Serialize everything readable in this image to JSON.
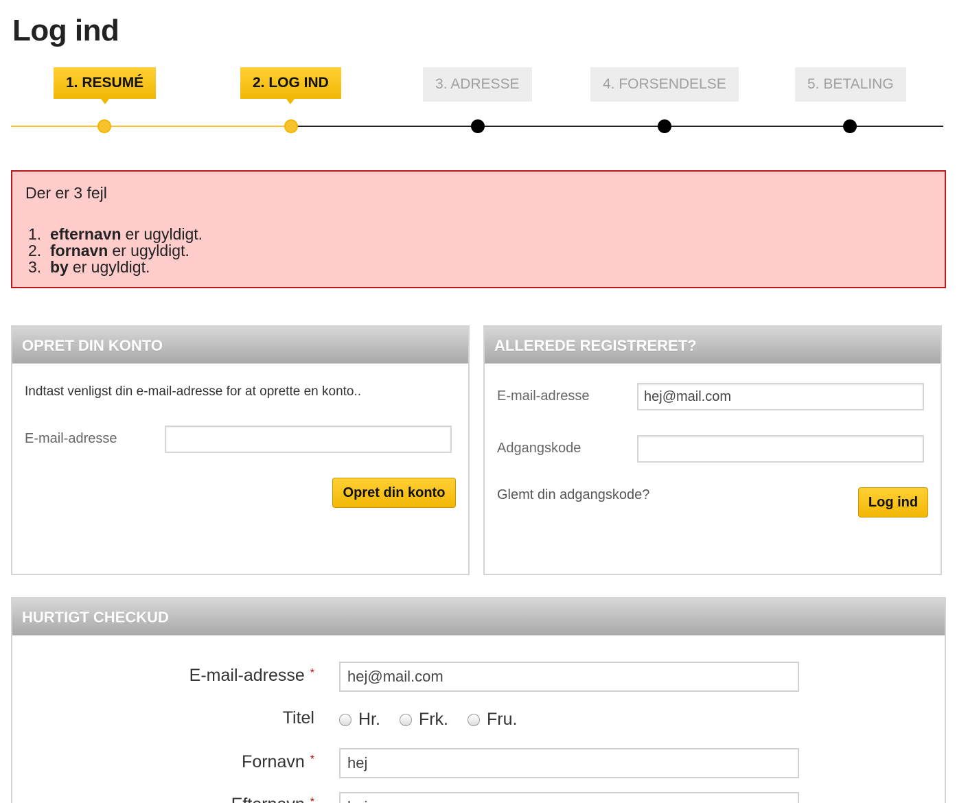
{
  "page": {
    "title": "Log ind"
  },
  "steps": [
    {
      "label": "1. RESUMÉ",
      "state": "active"
    },
    {
      "label": "2. LOG IND",
      "state": "active"
    },
    {
      "label": "3. ADRESSE",
      "state": "inactive"
    },
    {
      "label": "4. FORSENDELSE",
      "state": "inactive"
    },
    {
      "label": "5. BETALING",
      "state": "inactive"
    }
  ],
  "errors": {
    "title": "Der er 3 fejl",
    "items": [
      {
        "num": "1.",
        "field": "efternavn",
        "message": "er ugyldigt."
      },
      {
        "num": "2.",
        "field": "fornavn",
        "message": "er ugyldigt."
      },
      {
        "num": "3.",
        "field": "by",
        "message": "er ugyldigt."
      }
    ]
  },
  "create_account": {
    "header": "OPRET DIN KONTO",
    "intro": "Indtast venligst din e-mail-adresse for at oprette en konto..",
    "email_label": "E-mail-adresse",
    "email_value": "",
    "button": "Opret din konto"
  },
  "login": {
    "header": "ALLEREDE REGISTRERET?",
    "email_label": "E-mail-adresse",
    "email_value": "hej@mail.com",
    "password_label": "Adgangskode",
    "password_value": "",
    "forgot_link": "Glemt din adgangskode?",
    "button": "Log ind"
  },
  "quick_checkout": {
    "header": "HURTIGT CHECKUD",
    "email_label": "E-mail-adresse",
    "email_value": "hej@mail.com",
    "title_label": "Titel",
    "title_options": [
      "Hr.",
      "Frk.",
      "Fru."
    ],
    "firstname_label": "Fornavn",
    "firstname_value": "hej",
    "lastname_label": "Efternavn",
    "lastname_value": "hej",
    "required_mark": "*"
  },
  "colors": {
    "accent": "#f2b705",
    "error_bg": "#ffcccc",
    "error_border": "#b51a1a"
  }
}
